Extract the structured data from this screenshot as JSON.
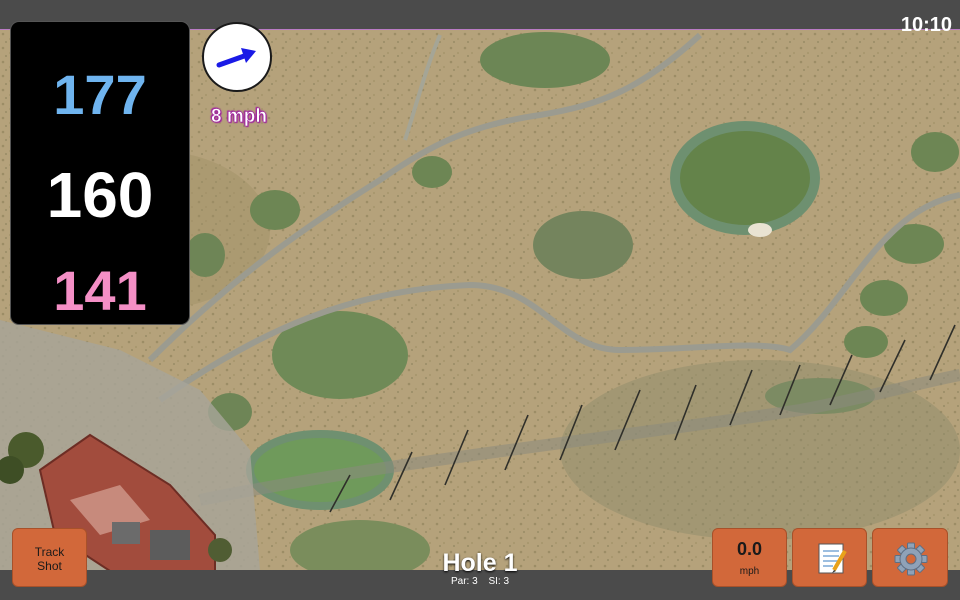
{
  "status_bar": {
    "time": "10:10"
  },
  "yardages": {
    "back": "177",
    "middle": "160",
    "front": "141"
  },
  "wind": {
    "speed_text": "8 mph",
    "direction_icon": "arrow-icon"
  },
  "hole": {
    "title": "Hole 1",
    "par": "Par: 3",
    "si": "SI: 3"
  },
  "buttons": {
    "track_shot": {
      "line1": "Track",
      "line2": "Shot"
    },
    "speed": {
      "value": "0.0",
      "unit": "mph"
    },
    "notes_icon": "notepad-icon",
    "settings_icon": "gear-icon"
  },
  "colors": {
    "back_yardage": "#6fb4ef",
    "middle_yardage": "#ffffff",
    "front_yardage": "#f48fc6",
    "button": "#d2683a",
    "wind_arrow": "#1a1ae6"
  }
}
